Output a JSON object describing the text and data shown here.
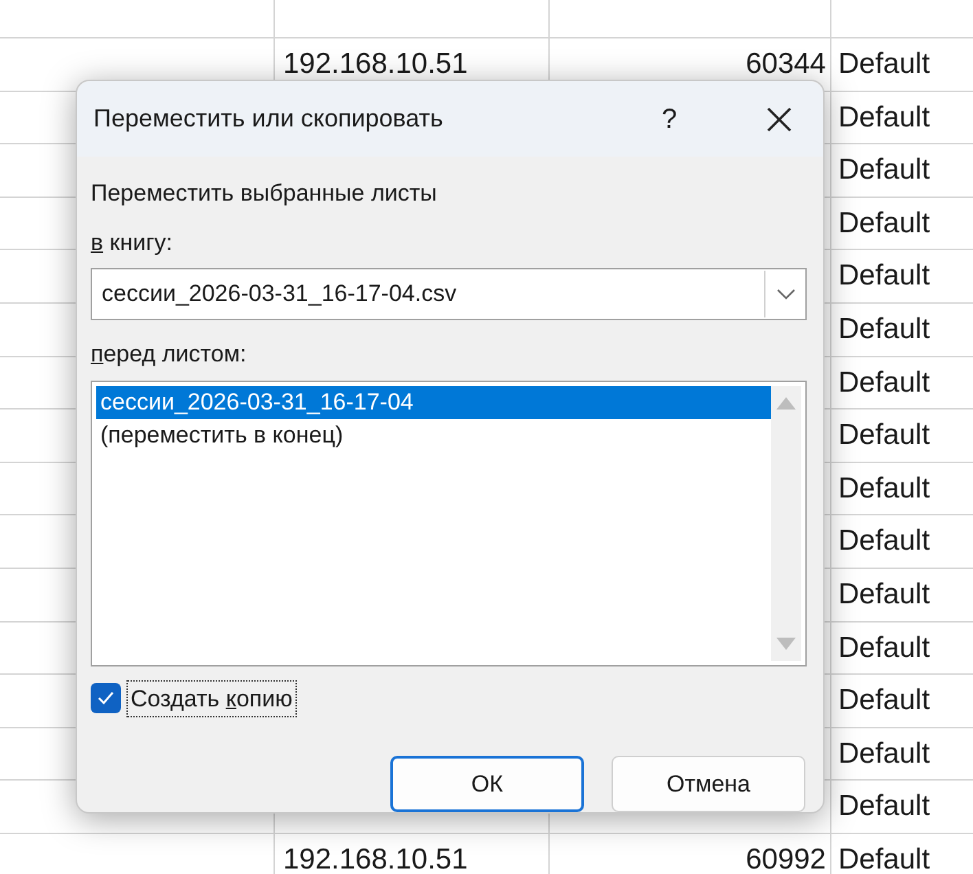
{
  "sheet": {
    "rows": [
      {
        "ip": "192.168.10.51",
        "port": "60344",
        "type": "Default"
      },
      {
        "type": "Default"
      },
      {
        "type": "Default"
      },
      {
        "type": "Default"
      },
      {
        "type": "Default"
      },
      {
        "type": "Default"
      },
      {
        "type": "Default"
      },
      {
        "type": "Default"
      },
      {
        "type": "Default"
      },
      {
        "type": "Default"
      },
      {
        "type": "Default"
      },
      {
        "type": "Default"
      },
      {
        "type": "Default"
      },
      {
        "type": "Default"
      },
      {
        "type": "Default"
      },
      {
        "ip": "192.168.10.51",
        "port": "60992",
        "type": "Default"
      }
    ]
  },
  "dialog": {
    "title": "Переместить или скопировать",
    "help": "?",
    "heading": "Переместить выбранные листы",
    "book_label": {
      "key": "в",
      "rest": " книгу:"
    },
    "book_value": "сессии_2026-03-31_16-17-04.csv",
    "before_label": {
      "key": "п",
      "rest": "еред листом:"
    },
    "sheets": [
      {
        "name": "сессии_2026-03-31_16-17-04",
        "selected": true
      },
      {
        "name": "(переместить в конец)",
        "selected": false
      }
    ],
    "copy": {
      "before": "Создать ",
      "key": "к",
      "after": "опию",
      "checked": true
    },
    "buttons": [
      {
        "label": "ОК",
        "default": true
      },
      {
        "label": "Отмена",
        "default": false
      }
    ]
  }
}
